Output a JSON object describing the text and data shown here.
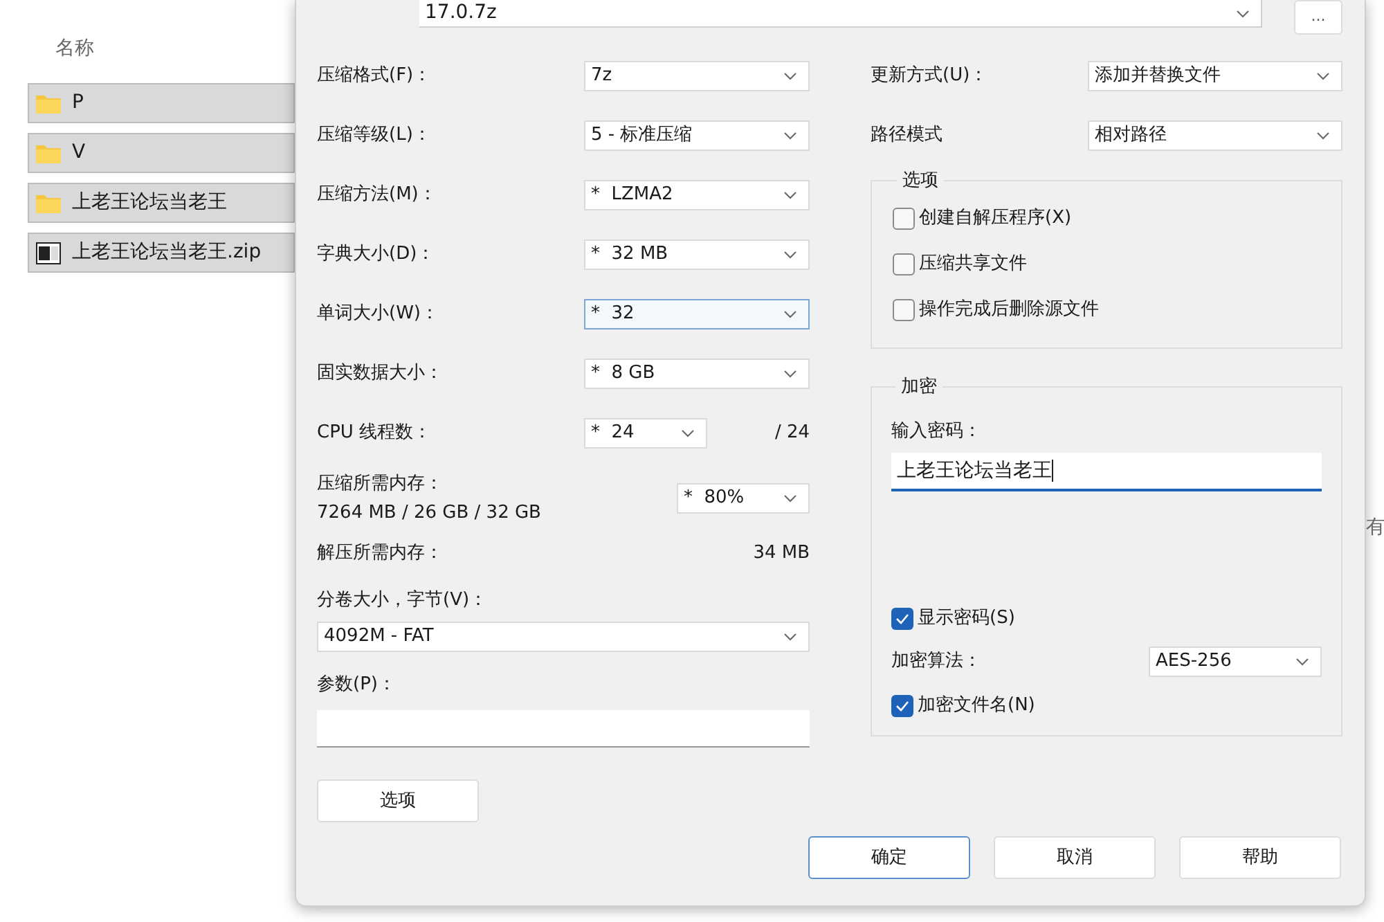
{
  "explorer": {
    "column_header": "名称",
    "items": [
      {
        "name": "P",
        "kind": "folder",
        "selected": true
      },
      {
        "name": "V",
        "kind": "folder",
        "selected": true
      },
      {
        "name": "上老王论坛当老王",
        "kind": "folder",
        "selected": true
      },
      {
        "name": "上老王论坛当老王.zip",
        "kind": "archive",
        "selected": true
      }
    ],
    "background_text": "有"
  },
  "dialog": {
    "archive_name": "17.0.7z",
    "browse_button": "...",
    "left_fields": [
      {
        "label": "压缩格式(F)：",
        "value": "7z",
        "focused": false
      },
      {
        "label": "压缩等级(L)：",
        "value": "5 - 标准压缩",
        "focused": false
      },
      {
        "label": "压缩方法(M)：",
        "value": "*  LZMA2",
        "focused": false
      },
      {
        "label": "字典大小(D)：",
        "value": "*  32 MB",
        "focused": false
      },
      {
        "label": "单词大小(W)：",
        "value": "*  32",
        "focused": true
      },
      {
        "label": "固实数据大小：",
        "value": "*  8 GB",
        "focused": false
      }
    ],
    "cpu_threads": {
      "label": "CPU 线程数：",
      "value": "*  24",
      "max": "/ 24"
    },
    "compress_memory": {
      "label": "压缩所需内存：",
      "reading": "7264 MB / 26 GB / 32 GB",
      "value": "*  80%"
    },
    "decompress_memory": {
      "label": "解压所需内存：",
      "reading": "34 MB"
    },
    "volume_size": {
      "label": "分卷大小，字节(V)：",
      "value": "4092M - FAT"
    },
    "parameters": {
      "label": "参数(P)："
    },
    "options_button": "选项",
    "right_fields": [
      {
        "label": "更新方式(U)：",
        "value": "添加并替换文件"
      },
      {
        "label": "路径模式",
        "value": "相对路径"
      }
    ],
    "options_group": {
      "title": "选项",
      "checkboxes": [
        {
          "label": "创建自解压程序(X)",
          "checked": false
        },
        {
          "label": "压缩共享文件",
          "checked": false
        },
        {
          "label": "操作完成后删除源文件",
          "checked": false
        }
      ]
    },
    "encryption": {
      "title": "加密",
      "password_label": "输入密码：",
      "password": "上老王论坛当老王",
      "show_password": {
        "label": "显示密码(S)",
        "checked": true
      },
      "method_label": "加密算法：",
      "method": "AES-256",
      "encrypt_names": {
        "label": "加密文件名(N)",
        "checked": true
      }
    },
    "buttons": [
      "确定",
      "取消",
      "帮助"
    ]
  }
}
